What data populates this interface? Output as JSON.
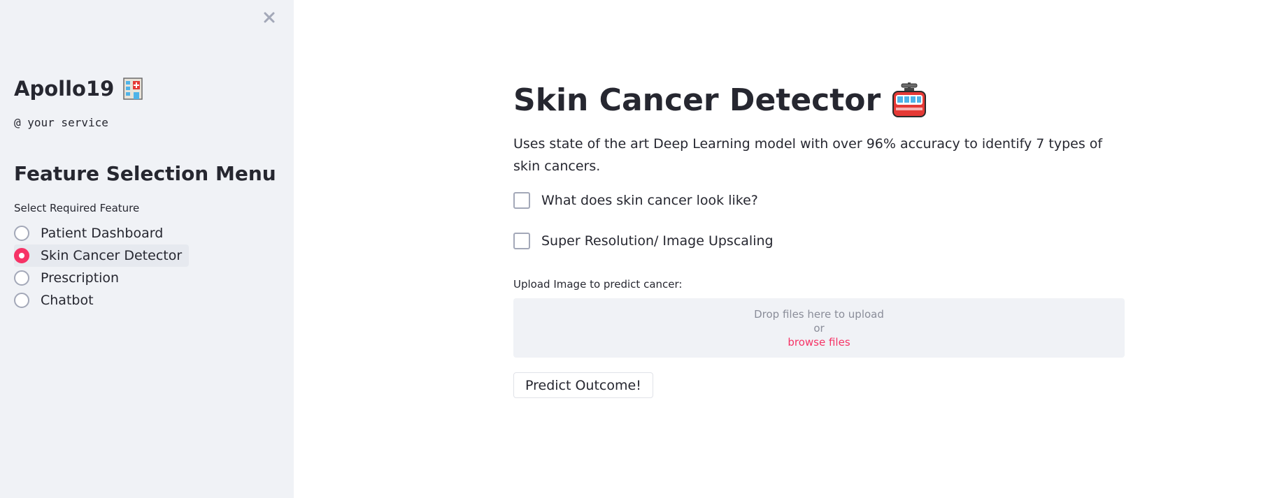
{
  "sidebar": {
    "app_name": "Apollo19",
    "app_emoji_icon": "hospital-icon",
    "subtitle": "@ your service",
    "menu_heading": "Feature Selection Menu",
    "radio_caption": "Select Required Feature",
    "options": [
      {
        "label": "Patient Dashboard",
        "selected": false
      },
      {
        "label": "Skin Cancer Detector",
        "selected": true
      },
      {
        "label": "Prescription",
        "selected": false
      },
      {
        "label": "Chatbot",
        "selected": false
      }
    ]
  },
  "main": {
    "title": "Skin Cancer Detector",
    "title_emoji_icon": "tram-car-icon",
    "description": "Uses state of the art Deep Learning model with over 96% accuracy to identify 7 types of skin cancers.",
    "checkboxes": [
      {
        "label": "What does skin cancer look like?",
        "checked": false
      },
      {
        "label": "Super Resolution/ Image Upscaling",
        "checked": false
      }
    ],
    "uploader": {
      "label": "Upload Image to predict cancer:",
      "drop_text": "Drop files here to upload",
      "or_text": "or",
      "browse_text": "browse files"
    },
    "predict_button": "Predict Outcome!"
  },
  "colors": {
    "accent": "#f63366",
    "sidebar_bg": "#f0f2f6",
    "text": "#262730"
  }
}
